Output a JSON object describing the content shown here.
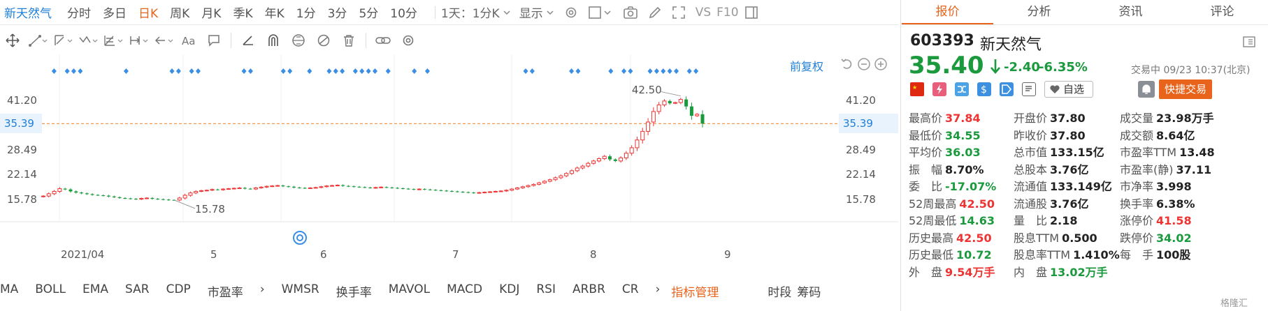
{
  "toolbar": {
    "stock_name": "新天然气",
    "timeframes": [
      "分时",
      "多日",
      "日K",
      "周K",
      "月K",
      "季K",
      "年K",
      "1分",
      "3分",
      "5分",
      "10分"
    ],
    "active_timeframe": "日K",
    "period_select": "1天：1分K",
    "display_label": "显示",
    "vs_label": "VS",
    "f10_label": "F10"
  },
  "chart": {
    "adjust_label": "前复权",
    "price_levels": [
      "41.20",
      "35.39",
      "28.49",
      "22.14",
      "15.78"
    ],
    "current_price_tag": "35.39",
    "high_annotation": "42.50",
    "low_annotation": "15.78",
    "month_labels": [
      "2021/04",
      "5",
      "6",
      "7",
      "8",
      "9"
    ],
    "colors": {
      "up": "#e33",
      "down": "#1a9a3c",
      "accent": "#e8641c",
      "event_marker": "#3a8ee6",
      "dashed_line": "#f08c3a"
    }
  },
  "chart_data": {
    "type": "candlestick",
    "ylim": [
      12,
      46
    ],
    "price_axis_ticks": [
      15.78,
      22.14,
      28.49,
      35.39,
      41.2
    ],
    "x_axis_ticks": [
      "2021/04",
      "5",
      "6",
      "7",
      "8",
      "9"
    ],
    "period_high": 42.5,
    "period_low": 15.78,
    "last_close": 35.4,
    "closes": [
      16.8,
      17.4,
      18.0,
      18.7,
      18.5,
      18.0,
      17.7,
      17.5,
      17.3,
      17.1,
      17.0,
      16.9,
      16.7,
      16.5,
      16.3,
      16.2,
      16.1,
      16.0,
      16.2,
      16.3,
      16.1,
      16.0,
      15.9,
      15.8,
      15.78,
      16.3,
      17.0,
      17.6,
      18.0,
      18.2,
      18.3,
      18.5,
      18.4,
      18.6,
      18.7,
      18.8,
      18.9,
      18.7,
      18.6,
      18.9,
      19.1,
      19.3,
      19.4,
      19.5,
      19.3,
      19.2,
      19.0,
      18.9,
      18.8,
      18.9,
      19.0,
      19.2,
      19.4,
      19.5,
      19.6,
      19.4,
      19.3,
      19.2,
      19.1,
      19.0,
      18.9,
      19.0,
      19.1,
      19.0,
      18.9,
      18.8,
      18.7,
      18.6,
      18.5,
      18.6,
      18.5,
      18.4,
      18.3,
      18.2,
      18.1,
      18.0,
      17.9,
      17.8,
      17.7,
      17.6,
      17.7,
      17.8,
      17.9,
      18.0,
      18.1,
      18.3,
      18.6,
      18.9,
      19.2,
      19.5,
      19.8,
      20.2,
      20.6,
      21.0,
      21.5,
      22.0,
      22.6,
      23.3,
      24.0,
      24.5,
      25.2,
      25.8,
      26.4,
      27.0,
      26.2,
      25.8,
      26.6,
      27.8,
      29.2,
      31.2,
      33.4,
      35.8,
      38.5,
      40.2,
      41.2,
      40.6,
      40.8,
      41.6,
      39.8,
      37.4,
      37.8,
      35.4
    ],
    "event_marker_count": 38
  },
  "indicators": {
    "items": [
      "MA",
      "BOLL",
      "EMA",
      "SAR",
      "CDP",
      "市盈率",
      "WMSR",
      "换手率",
      "MAVOL",
      "MACD",
      "KDJ",
      "RSI",
      "ARBR",
      "CR"
    ],
    "manage_label": "指标管理",
    "right_items": [
      "时段",
      "筹码"
    ]
  },
  "panel": {
    "tabs": [
      "报价",
      "分析",
      "资讯",
      "评论"
    ],
    "active_tab": "报价",
    "code": "603393",
    "name": "新天然气",
    "price": "35.40",
    "change": "-2.40",
    "change_pct": "-6.35%",
    "status": "交易中 09/23 10:37(北京)",
    "watch_label": "自选",
    "quick_trade_label": "快捷交易",
    "stats": [
      [
        {
          "k": "最高价",
          "v": "37.84",
          "c": "red"
        },
        {
          "k": "开盘价",
          "v": "37.80",
          "c": "dark"
        },
        {
          "k": "成交量",
          "v": "23.98万手",
          "c": "dark"
        }
      ],
      [
        {
          "k": "最低价",
          "v": "34.55",
          "c": "green"
        },
        {
          "k": "昨收价",
          "v": "37.80",
          "c": "dark"
        },
        {
          "k": "成交额",
          "v": "8.64亿",
          "c": "dark"
        }
      ],
      [
        {
          "k": "平均价",
          "v": "36.03",
          "c": "green"
        },
        {
          "k": "总市值",
          "v": "133.15亿",
          "c": "dark"
        },
        {
          "k": "市盈率TTM",
          "v": "13.48",
          "c": "dark"
        }
      ],
      [
        {
          "k": "振　幅",
          "v": "8.70%",
          "c": "dark"
        },
        {
          "k": "总股本",
          "v": "3.76亿",
          "c": "dark"
        },
        {
          "k": "市盈率(静)",
          "v": "37.11",
          "c": "dark"
        }
      ],
      [
        {
          "k": "委　比",
          "v": "-17.07%",
          "c": "green"
        },
        {
          "k": "流通值",
          "v": "133.149亿",
          "c": "dark"
        },
        {
          "k": "市净率",
          "v": "3.998",
          "c": "dark"
        }
      ],
      [
        {
          "k": "52周最高",
          "v": "42.50",
          "c": "red"
        },
        {
          "k": "流通股",
          "v": "3.76亿",
          "c": "dark"
        },
        {
          "k": "换手率",
          "v": "6.38%",
          "c": "dark"
        }
      ],
      [
        {
          "k": "52周最低",
          "v": "14.63",
          "c": "green"
        },
        {
          "k": "量　比",
          "v": "2.18",
          "c": "dark"
        },
        {
          "k": "涨停价",
          "v": "41.58",
          "c": "red"
        }
      ],
      [
        {
          "k": "历史最高",
          "v": "42.50",
          "c": "red"
        },
        {
          "k": "股息TTM",
          "v": "0.500",
          "c": "dark"
        },
        {
          "k": "跌停价",
          "v": "34.02",
          "c": "green"
        }
      ],
      [
        {
          "k": "历史最低",
          "v": "10.72",
          "c": "green"
        },
        {
          "k": "股息率TTM",
          "v": "1.410%",
          "c": "dark"
        },
        {
          "k": "每　手",
          "v": "100股",
          "c": "dark"
        }
      ],
      [
        {
          "k": "外　盘",
          "v": "9.54万手",
          "c": "red"
        },
        {
          "k": "内　盘",
          "v": "13.02万手",
          "c": "green"
        },
        {
          "k": "",
          "v": "",
          "c": "dark"
        }
      ]
    ],
    "watermark": "格隆汇"
  }
}
